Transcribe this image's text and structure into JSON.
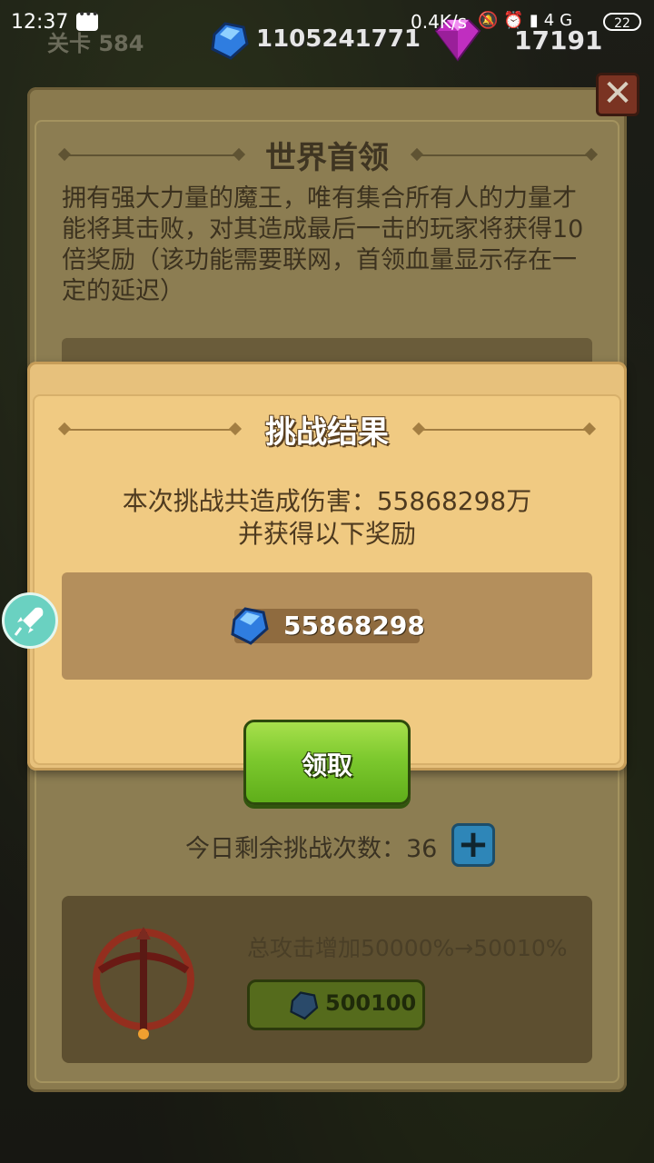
{
  "status_bar": {
    "time": "12:37",
    "network_speed": "0.4K/s",
    "network_type": "4G",
    "battery": "22"
  },
  "hud": {
    "level_label": "关卡 584",
    "blue_gems": "1105241771",
    "purple_gems": "17191"
  },
  "world_boss": {
    "title": "世界首领",
    "description": "拥有强大力量的魔王，唯有集合所有人的力量才能将其击败，对其造成最后一击的玩家将获得10倍奖励（该功能需要联网，首领血量显示存在一定的延迟）",
    "remaining_label": "今日剩余挑战次数：36",
    "upgrade_text": "总攻击增加50000%→50010%",
    "upgrade_cost": "500100"
  },
  "result_dialog": {
    "title": "挑战结果",
    "damage_line": "本次挑战共造成伤害：55868298万",
    "reward_line": "并获得以下奖励",
    "reward_value": "55868298",
    "claim_label": "领取"
  },
  "colors": {
    "dialog_bg": "#f0ca82",
    "claim_green": "#7dc92e",
    "gem_blue": "#2f7de0",
    "gem_purple": "#c02ec0"
  },
  "icons": [
    "chat-icon",
    "blue-gem-icon",
    "purple-gem-icon",
    "close-icon",
    "rocket-icon",
    "plus-icon",
    "crossbow-icon"
  ]
}
